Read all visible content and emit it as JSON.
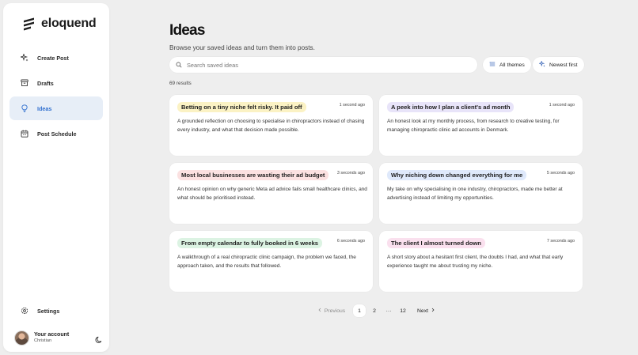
{
  "brand": {
    "name": "eloquend"
  },
  "sidebar": {
    "items": [
      {
        "label": "Create Post",
        "icon": "sparkle-icon",
        "active": false
      },
      {
        "label": "Drafts",
        "icon": "archive-icon",
        "active": false
      },
      {
        "label": "Ideas",
        "icon": "lightbulb-icon",
        "active": true
      },
      {
        "label": "Post Schedule",
        "icon": "calendar-icon",
        "active": false
      }
    ],
    "settings_label": "Settings",
    "account": {
      "name": "Your account",
      "user": "Christian"
    }
  },
  "page": {
    "title": "Ideas",
    "subtitle": "Browse your saved ideas and turn them into posts.",
    "search_placeholder": "Search saved ideas",
    "filter_label": "All themes",
    "sort_label": "Newest first",
    "results": "69 results"
  },
  "cards": [
    {
      "title": "Betting on a tiny niche felt risky. It paid off",
      "time": "1 second ago",
      "desc": "A grounded reflection on choosing to specialise in chiropractors instead of chasing every industry, and what that decision made possible.",
      "tag_color": "#fbf2c4"
    },
    {
      "title": "A peek into how I plan a client's ad month",
      "time": "1 second ago",
      "desc": "An honest look at my monthly process, from research to creative testing, for managing chiropractic clinic ad accounts in Denmark.",
      "tag_color": "#e8e4f9"
    },
    {
      "title": "Most local businesses are wasting their ad budget",
      "time": "3 seconds ago",
      "desc": "An honest opinion on why generic Meta ad advice fails small healthcare clinics, and what should be prioritised instead.",
      "tag_color": "#fbe1e1"
    },
    {
      "title": "Why niching down changed everything for me",
      "time": "5 seconds ago",
      "desc": "My take on why specialising in one industry, chiropractors, made me better at advertising instead of limiting my opportunities.",
      "tag_color": "#dfe9fb"
    },
    {
      "title": "From empty calendar to fully booked in 6 weeks",
      "time": "6 seconds ago",
      "desc": "A walkthrough of a real chiropractic clinic campaign, the problem we faced, the approach taken, and the results that followed.",
      "tag_color": "#dcf3e3"
    },
    {
      "title": "The client I almost turned down",
      "time": "7 seconds ago",
      "desc": "A short story about a hesitant first client, the doubts I had, and what that early experience taught me about trusting my niche.",
      "tag_color": "#fae0ee"
    }
  ],
  "pagination": {
    "previous": "Previous",
    "pages": [
      "1",
      "2",
      "···",
      "12"
    ],
    "current": "1",
    "next": "Next"
  },
  "colors": {
    "accent": "#2f6fcf",
    "active_nav_bg": "#e7eef7",
    "background": "#eeeeee"
  }
}
